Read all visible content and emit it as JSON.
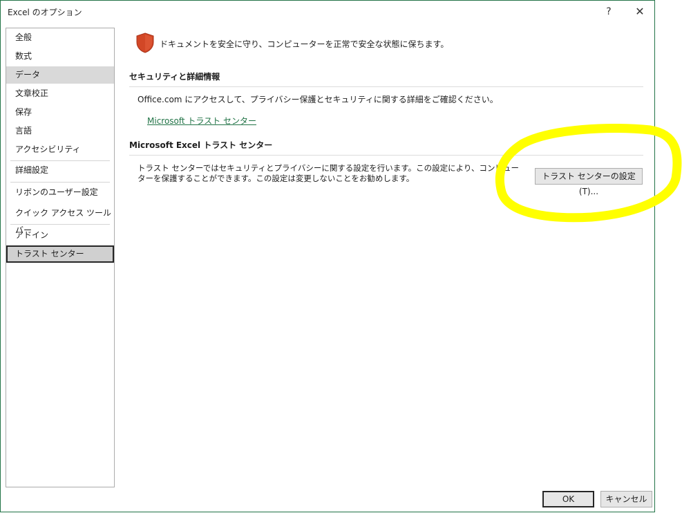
{
  "window": {
    "title": "Excel のオプション",
    "help_label": "?",
    "close_label": "✕"
  },
  "sidebar": {
    "items": [
      {
        "label": "全般"
      },
      {
        "label": "数式"
      },
      {
        "label": "データ"
      },
      {
        "label": "文章校正"
      },
      {
        "label": "保存"
      },
      {
        "label": "言語"
      },
      {
        "label": "アクセシビリティ"
      },
      {
        "label": "詳細設定"
      },
      {
        "label": "リボンのユーザー設定"
      },
      {
        "label": "クイック アクセス ツール バー"
      },
      {
        "label": "アドイン"
      },
      {
        "label": "トラスト センター"
      }
    ],
    "selected": "トラスト センター",
    "hovered": "データ"
  },
  "main": {
    "intro": "ドキュメントを安全に守り、コンピューターを正常で安全な状態に保ちます。",
    "security_section": {
      "title": "セキュリティと詳細情報",
      "text": "Office.com にアクセスして、プライバシー保護とセキュリティに関する詳細をご確認ください。",
      "link": "Microsoft トラスト センター"
    },
    "trust_center_section": {
      "title": "Microsoft Excel トラスト センター",
      "description": "トラスト センターではセキュリティとプライバシーに関する設定を行います。この設定により、コンピューターを保護することができます。この設定は変更しないことをお勧めします。",
      "button": "トラスト センターの設定(T)..."
    }
  },
  "footer": {
    "ok": "OK",
    "cancel": "キャンセル"
  },
  "colors": {
    "accent": "#217346",
    "shield": "#d24726",
    "highlight": "#ffff00"
  }
}
